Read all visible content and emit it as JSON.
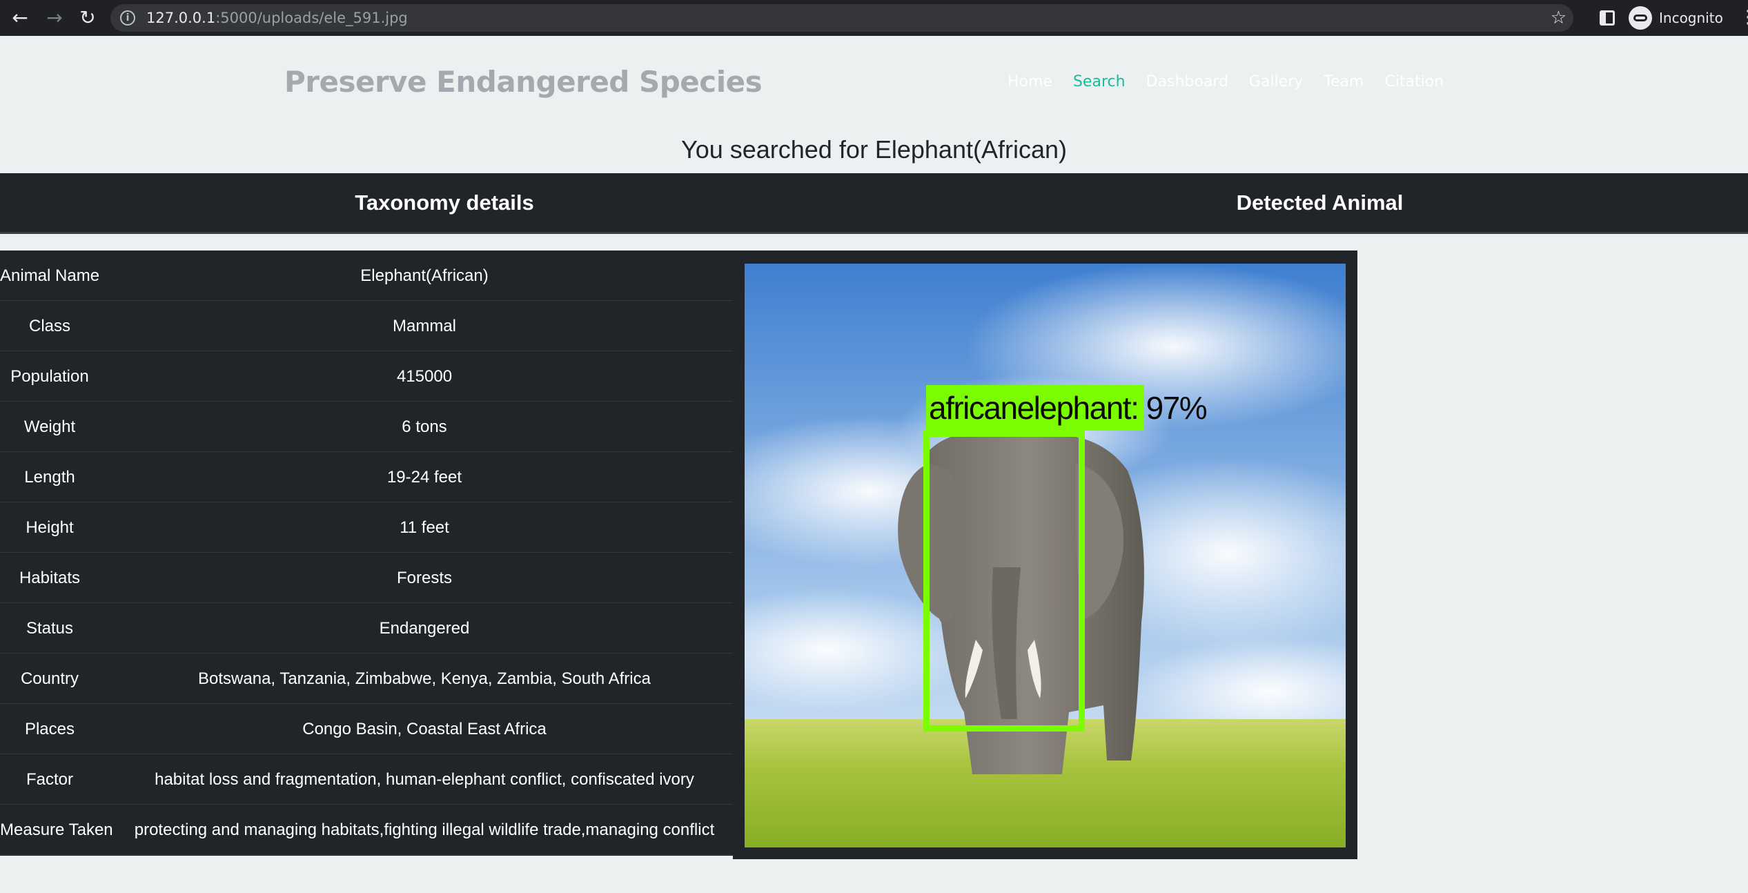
{
  "browser": {
    "back_icon": "arrow-left-icon",
    "forward_icon": "arrow-right-icon",
    "reload_icon": "reload-icon",
    "url_host": "127.0.0.1",
    "url_path": ":5000/uploads/ele_591.jpg",
    "incognito_label": "Incognito"
  },
  "site": {
    "brand": "Preserve Endangered Species",
    "nav": [
      {
        "label": "Home",
        "active": false
      },
      {
        "label": "Search",
        "active": true
      },
      {
        "label": "Dashboard",
        "active": false
      },
      {
        "label": "Gallery",
        "active": false
      },
      {
        "label": "Team",
        "active": false
      },
      {
        "label": "Citation",
        "active": false
      }
    ],
    "accent_color": "#18bc9c"
  },
  "search_heading": "You searched for Elephant(African)",
  "sections": {
    "taxonomy_title": "Taxonomy details",
    "detected_title": "Detected Animal"
  },
  "taxonomy": [
    {
      "key": "Animal Name",
      "value": "Elephant(African)"
    },
    {
      "key": "Class",
      "value": "Mammal"
    },
    {
      "key": "Population",
      "value": "415000"
    },
    {
      "key": "Weight",
      "value": "6 tons"
    },
    {
      "key": "Length",
      "value": "19-24 feet"
    },
    {
      "key": "Height",
      "value": "11 feet"
    },
    {
      "key": "Habitats",
      "value": "Forests"
    },
    {
      "key": "Status",
      "value": "Endangered"
    },
    {
      "key": "Country",
      "value": "Botswana, Tanzania, Zimbabwe, Kenya, Zambia, South Africa"
    },
    {
      "key": "Places",
      "value": "Congo Basin, Coastal East Africa"
    },
    {
      "key": "Factor",
      "value": "habitat loss and fragmentation, human-elephant conflict, confiscated ivory"
    },
    {
      "key": "Measure Taken",
      "value": "protecting and managing habitats,fighting illegal wildlife trade,managing conflict"
    }
  ],
  "detection": {
    "label": "africanelephant: 97%",
    "box_color": "#7cfc00"
  }
}
